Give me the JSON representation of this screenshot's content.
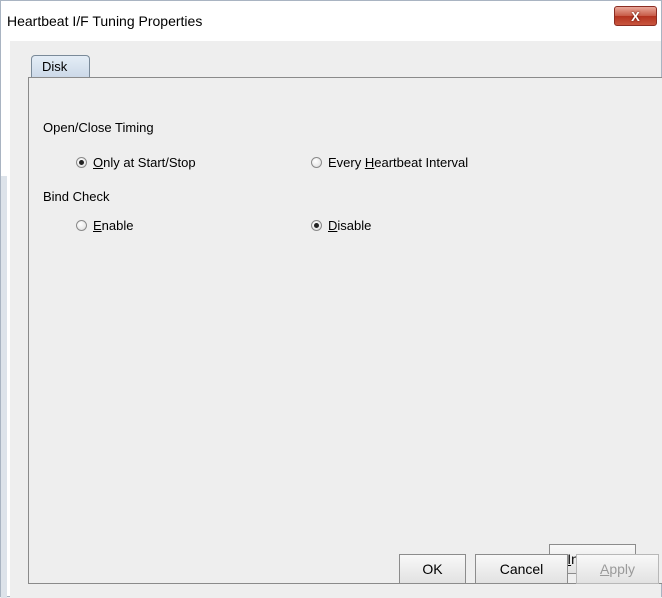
{
  "window": {
    "title": "Heartbeat I/F Tuning Properties",
    "close_label": "X"
  },
  "tabs": [
    {
      "label": "Disk",
      "selected": true
    }
  ],
  "open_close_timing": {
    "label": "Open/Close Timing",
    "options": [
      {
        "prefix": "",
        "mnemonic": "O",
        "suffix": "nly at Start/Stop",
        "checked": true
      },
      {
        "prefix": "Every ",
        "mnemonic": "H",
        "suffix": "eartbeat Interval",
        "checked": false
      }
    ]
  },
  "bind_check": {
    "label": "Bind Check",
    "options": [
      {
        "prefix": "",
        "mnemonic": "E",
        "suffix": "nable",
        "checked": false
      },
      {
        "prefix": "",
        "mnemonic": "D",
        "suffix": "isable",
        "checked": true
      }
    ]
  },
  "buttons": {
    "initialize": {
      "mnemonic": "I",
      "rest": "nitialize"
    },
    "ok": "OK",
    "cancel": "Cancel",
    "apply": {
      "mnemonic": "A",
      "rest": "pply",
      "enabled": false
    }
  }
}
